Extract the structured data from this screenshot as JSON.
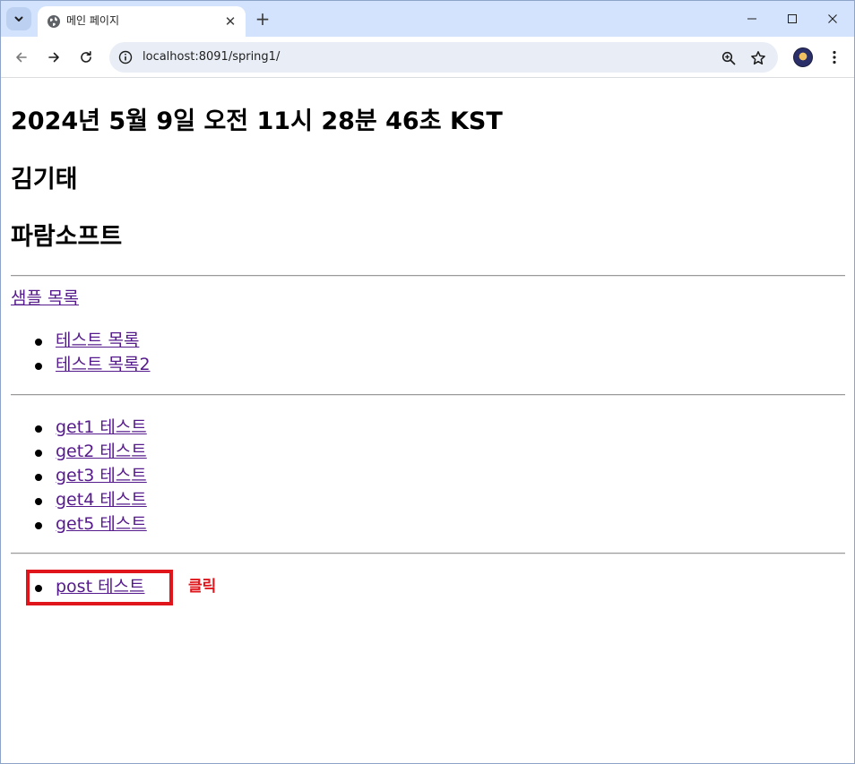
{
  "browser": {
    "tab": {
      "title": "메인 페이지"
    },
    "new_tab_symbol": "+",
    "tab_close_symbol": "✕",
    "url": "localhost:8091/spring1/",
    "icons": {
      "tab_search": "chevron-down-icon",
      "favicon": "globe-icon",
      "back": "arrow-left-icon",
      "forward": "arrow-right-icon",
      "reload": "reload-icon",
      "site_info": "info-icon",
      "zoom": "zoom-icon",
      "bookmark": "star-icon",
      "menu": "kebab-menu-icon"
    },
    "colors": {
      "tabstrip": "#d3e3fd",
      "omnibox": "#e9eef6"
    }
  },
  "page": {
    "date_heading": "2024년 5월 9일 오전 11시 28분 46초 KST",
    "name_heading": "김기태",
    "company_heading": "파람소프트",
    "sample_link": "샘플 목록",
    "test_list": [
      {
        "label": "테스트 목록"
      },
      {
        "label": "테스트 목록2"
      }
    ],
    "get_list": [
      {
        "label": "get1 테스트"
      },
      {
        "label": "get2 테스트"
      },
      {
        "label": "get3 테스트"
      },
      {
        "label": "get4 테스트"
      },
      {
        "label": "get5 테스트"
      }
    ],
    "post_list": [
      {
        "label": "post 테스트"
      }
    ],
    "annotation": {
      "text": "클릭",
      "color": "#e0141b"
    },
    "link_color": "#551a8b"
  }
}
